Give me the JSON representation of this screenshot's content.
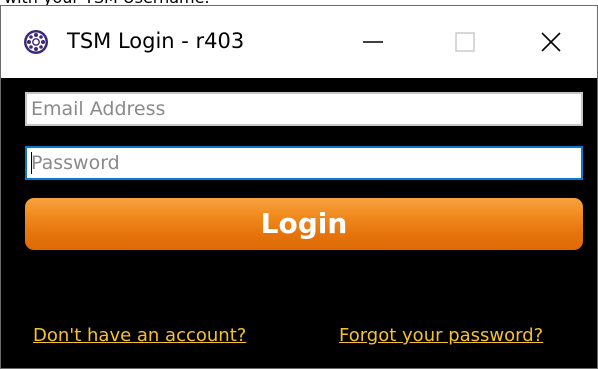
{
  "page": {
    "caption": "with your TSM Username."
  },
  "window": {
    "title": "TSM Login - r403",
    "app_icon": "gear-icon",
    "controls": {
      "minimize_icon": "minimize-icon",
      "maximize_icon": "maximize-icon",
      "close_icon": "close-icon"
    }
  },
  "form": {
    "email": {
      "placeholder": "Email Address",
      "value": ""
    },
    "password": {
      "placeholder": "Password",
      "value": ""
    },
    "login_label": "Login"
  },
  "links": {
    "signup": "Don't have an account?",
    "forgot": "Forgot your password?"
  },
  "colors": {
    "background": "#000000",
    "accent_orange": "#f08a1d",
    "link_yellow": "#f6c12b",
    "focus_blue": "#0a78d7"
  }
}
